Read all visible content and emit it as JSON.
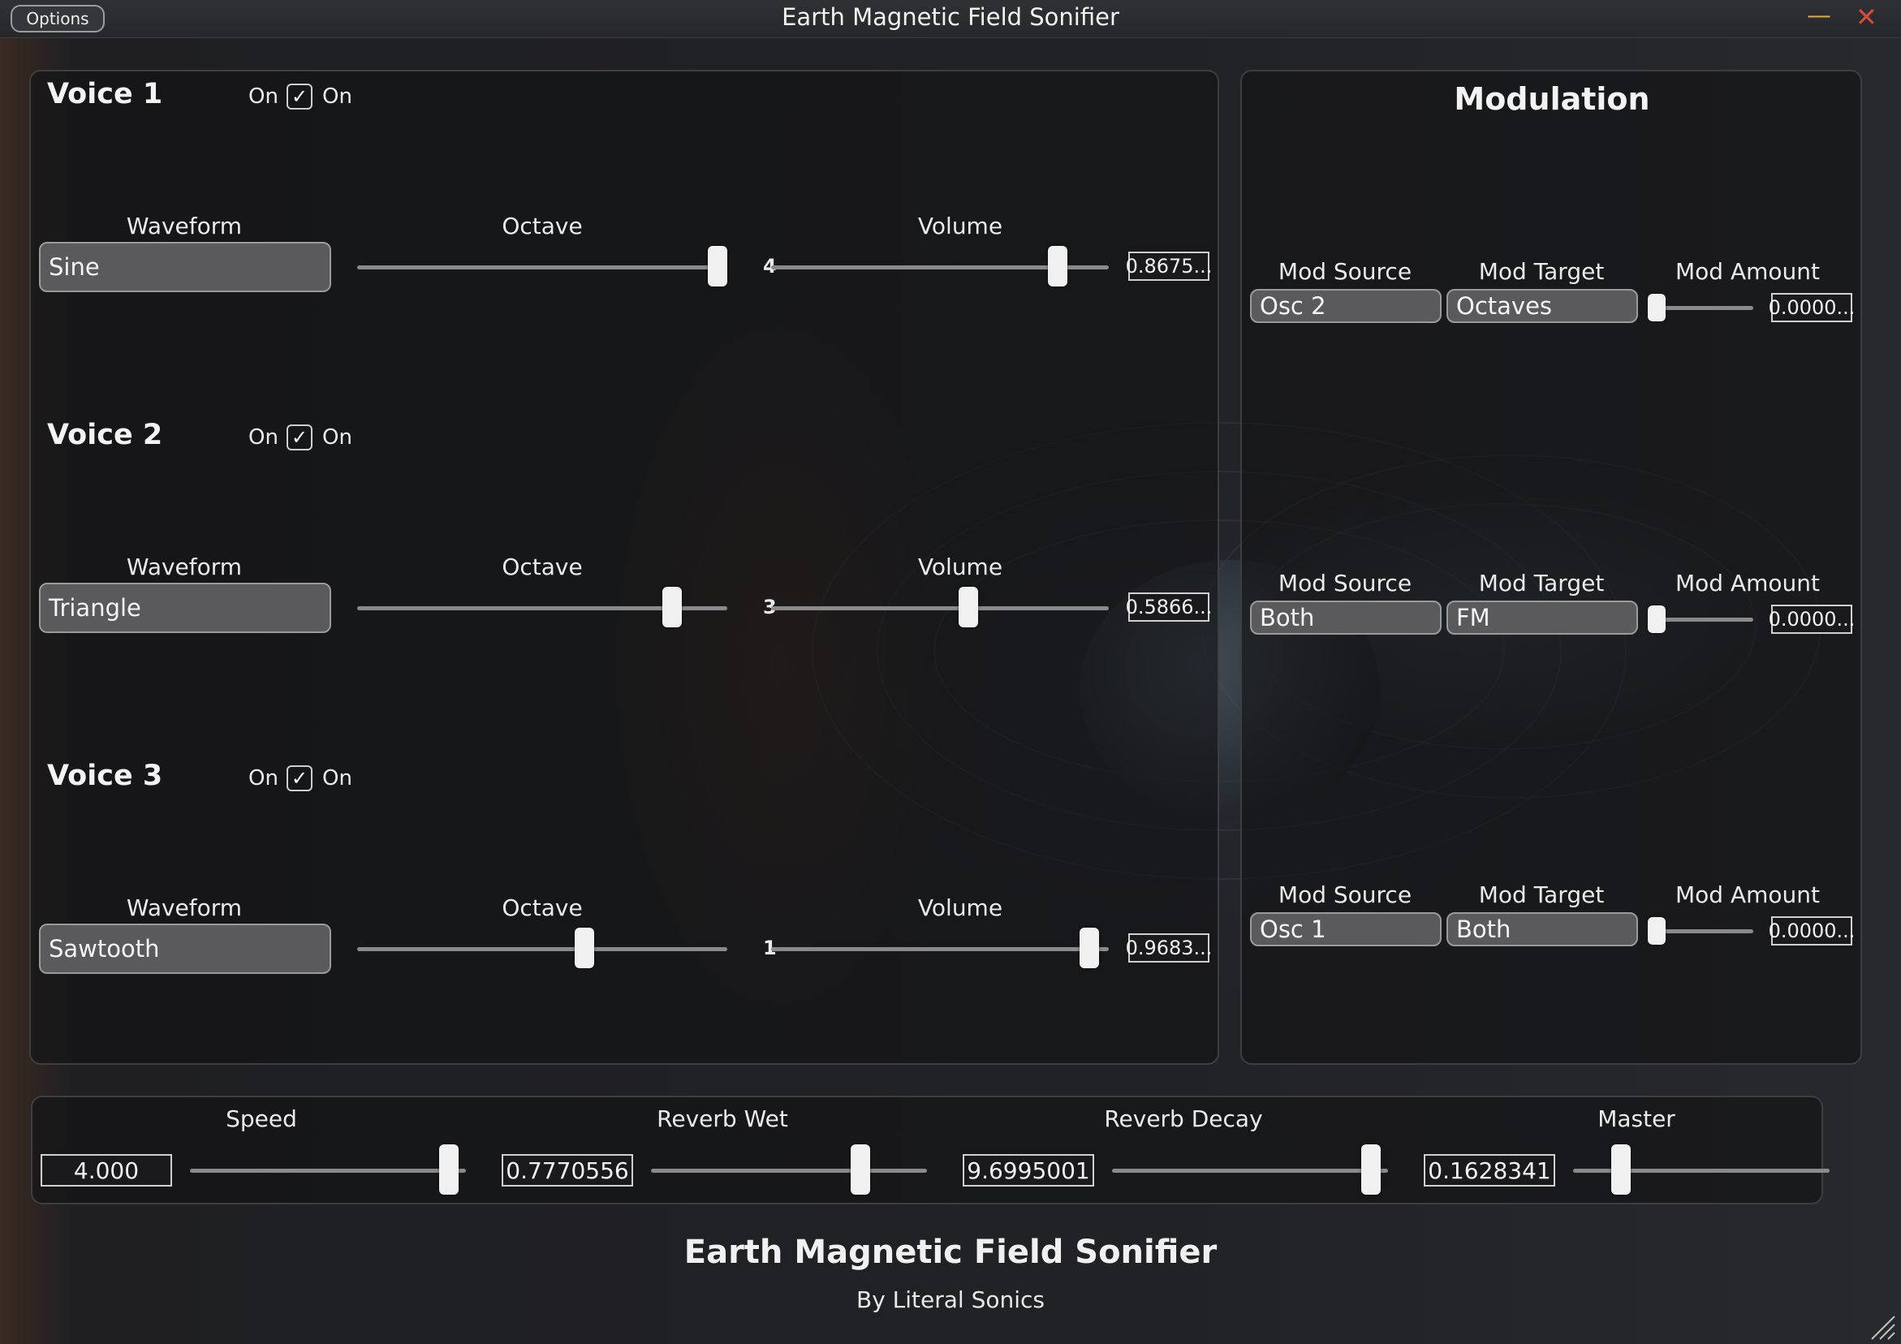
{
  "window": {
    "title": "Earth Magnetic Field Sonifier",
    "options_label": "Options",
    "minimize_glyph": "—",
    "close_glyph": "✕"
  },
  "voices": [
    {
      "title": "Voice 1",
      "on_label_left": "On",
      "on_label_right": "On",
      "checked": true,
      "waveform_label": "Waveform",
      "waveform": "Sine",
      "octave_label": "Octave",
      "octave": "4",
      "octave_fraction": 1.0,
      "volume_label": "Volume",
      "volume": "0.8675...",
      "volume_fraction": 0.87
    },
    {
      "title": "Voice 2",
      "on_label_left": "On",
      "on_label_right": "On",
      "checked": true,
      "waveform_label": "Waveform",
      "waveform": "Triangle",
      "octave_label": "Octave",
      "octave": "3",
      "octave_fraction": 0.87,
      "volume_label": "Volume",
      "volume": "0.5866...",
      "volume_fraction": 0.59
    },
    {
      "title": "Voice 3",
      "on_label_left": "On",
      "on_label_right": "On",
      "checked": true,
      "waveform_label": "Waveform",
      "waveform": "Sawtooth",
      "octave_label": "Octave",
      "octave": "1",
      "octave_fraction": 0.62,
      "volume_label": "Volume",
      "volume": "0.9683...",
      "volume_fraction": 0.97
    }
  ],
  "modulation": {
    "title": "Modulation",
    "rows": [
      {
        "source_label": "Mod Source",
        "source": "Osc 2",
        "target_label": "Mod Target",
        "target": "Octaves",
        "amount_label": "Mod Amount",
        "amount": "0.0000...",
        "amount_fraction": 0.0
      },
      {
        "source_label": "Mod Source",
        "source": "Both",
        "target_label": "Mod Target",
        "target": "FM",
        "amount_label": "Mod Amount",
        "amount": "0.0000...",
        "amount_fraction": 0.0
      },
      {
        "source_label": "Mod Source",
        "source": "Osc 1",
        "target_label": "Mod Target",
        "target": "Both",
        "amount_label": "Mod Amount",
        "amount": "0.0000...",
        "amount_fraction": 0.0
      }
    ]
  },
  "globals": [
    {
      "label": "Speed",
      "value": "4.000",
      "fraction": 0.97
    },
    {
      "label": "Reverb Wet",
      "value": "0.7770556",
      "fraction": 0.78
    },
    {
      "label": "Reverb Decay",
      "value": "9.6995001",
      "fraction": 0.97
    },
    {
      "label": "Master",
      "value": "0.1628341",
      "fraction": 0.16
    }
  ],
  "footer": {
    "title": "Earth Magnetic Field Sonifier",
    "subtitle": "By Literal Sonics"
  },
  "icons": {
    "checkbox": "checkmark-icon",
    "resize": "resize-grip-icon"
  }
}
